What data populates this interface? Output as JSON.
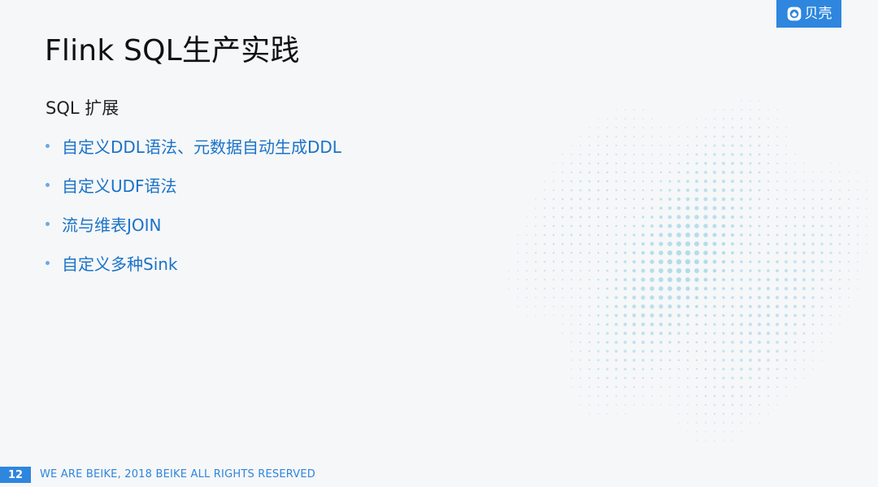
{
  "header": {
    "title": "Flink SQL生产实践",
    "logo_text": "贝壳",
    "logo_icon": "beike-logo-icon"
  },
  "content": {
    "section_title": "SQL 扩展",
    "bullets": [
      "自定义DDL语法、元数据自动生成DDL",
      "自定义UDF语法",
      "流与维表JOIN",
      "自定义多种Sink"
    ]
  },
  "footer": {
    "page_number": "12",
    "copyright": "WE ARE BEIKE, 2018 BEIKE ALL RIGHTS RESERVED"
  },
  "colors": {
    "accent": "#2e86de",
    "bullet_text": "#1a73c8",
    "title_text": "#111111",
    "background": "#f6f7f8"
  }
}
